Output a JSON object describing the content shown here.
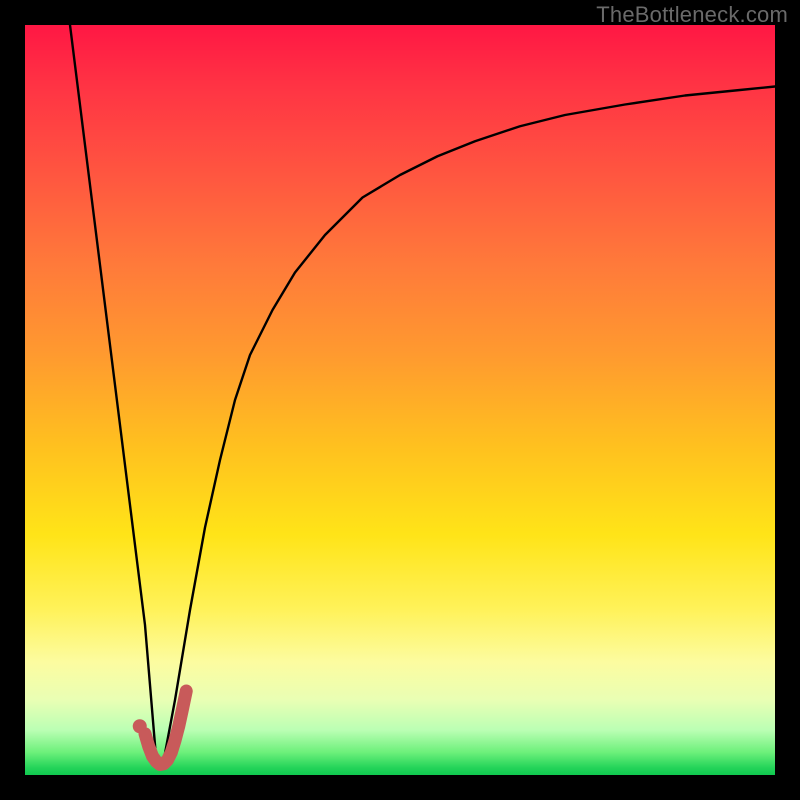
{
  "watermark": "TheBottleneck.com",
  "chart_data": {
    "type": "line",
    "title": "",
    "xlabel": "",
    "ylabel": "",
    "xlim": [
      0,
      100
    ],
    "ylim": [
      0,
      100
    ],
    "grid": false,
    "legend": false,
    "series": [
      {
        "name": "black-curve-left-branch",
        "x": [
          6,
          7,
          8,
          9,
          10,
          11,
          12,
          13,
          14,
          15,
          16,
          16.5,
          17,
          17.5
        ],
        "values": [
          100,
          92,
          84,
          76,
          68,
          60,
          52,
          44,
          36,
          28,
          20,
          14,
          8,
          2
        ]
      },
      {
        "name": "black-curve-right-branch",
        "x": [
          18.5,
          20,
          22,
          24,
          26,
          28,
          30,
          33,
          36,
          40,
          45,
          50,
          55,
          60,
          66,
          72,
          80,
          88,
          95,
          100
        ],
        "values": [
          2,
          10,
          22,
          33,
          42,
          50,
          56,
          62,
          67,
          72,
          77,
          80,
          82.5,
          84.5,
          86.5,
          88,
          89.4,
          90.6,
          91.3,
          91.8
        ]
      },
      {
        "name": "red-marker-hook",
        "x": [
          16,
          16.5,
          17,
          17.5,
          18,
          18.5,
          19,
          19.5,
          20,
          20.5,
          21,
          21.5
        ],
        "values": [
          5.5,
          3.8,
          2.5,
          1.8,
          1.4,
          1.5,
          2.0,
          3.0,
          4.6,
          6.5,
          8.8,
          11.2
        ]
      },
      {
        "name": "red-marker-dot",
        "x": [
          15.3
        ],
        "values": [
          6.5
        ]
      }
    ],
    "colors": {
      "curve": "#000000",
      "marker": "#c85a5a"
    }
  }
}
